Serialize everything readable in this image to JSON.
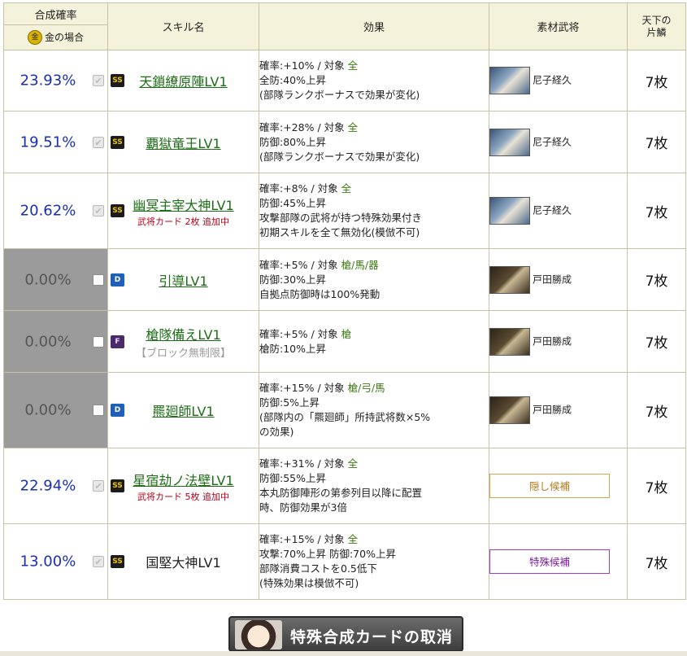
{
  "header": {
    "rate_title": "合成確率",
    "rate_gold_icon": "金",
    "rate_gold_label": "金の場合",
    "skill_name": "スキル名",
    "effect": "効果",
    "material": "素材武将",
    "count_line1": "天下の",
    "count_line2": "片鱗"
  },
  "rows": [
    {
      "rate": "23.93%",
      "checkbox": "checked-disabled",
      "rank": "SS",
      "name": "天鎖繚原陣LV1",
      "linked": true,
      "sub": "",
      "effects": [
        {
          "pre": "確率:+10%  /  対象  ",
          "tgt": "全"
        },
        {
          "pre": "全防:40%上昇"
        },
        {
          "pre": "(部隊ランクボーナスで効果が変化)"
        }
      ],
      "material": {
        "type": "general",
        "portrait": "blue",
        "name": "尼子経久"
      },
      "count": "7枚"
    },
    {
      "rate": "19.51%",
      "checkbox": "checked-disabled",
      "rank": "SS",
      "name": "覇獄竜王LV1",
      "linked": true,
      "sub": "",
      "effects": [
        {
          "pre": "確率:+28%  /  対象  ",
          "tgt": "全"
        },
        {
          "pre": "防御:80%上昇"
        },
        {
          "pre": "(部隊ランクボーナスで効果が変化)"
        }
      ],
      "material": {
        "type": "general",
        "portrait": "blue",
        "name": "尼子経久"
      },
      "count": "7枚"
    },
    {
      "rate": "20.62%",
      "checkbox": "checked-disabled",
      "rank": "SS",
      "name": "幽冥主宰大神LV1",
      "linked": true,
      "sub": "武将カード 2枚 追加中",
      "effects": [
        {
          "pre": "確率:+8%  /  対象  ",
          "tgt": "全"
        },
        {
          "pre": "防御:45%上昇"
        },
        {
          "pre": "攻撃部隊の武将が持つ特殊効果付き"
        },
        {
          "pre": "初期スキルを全て無効化(模倣不可)"
        }
      ],
      "material": {
        "type": "general",
        "portrait": "blue",
        "name": "尼子経久"
      },
      "count": "7枚"
    },
    {
      "rate": "0.00%",
      "grey": true,
      "checkbox": "empty",
      "rank": "D",
      "name": "引導LV1",
      "linked": true,
      "sub": "",
      "effects": [
        {
          "pre": "確率:+5%  /  対象  ",
          "tgt": "槍/馬/器"
        },
        {
          "pre": "防御:30%上昇"
        },
        {
          "pre": "自拠点防御時は100%発動"
        }
      ],
      "material": {
        "type": "general",
        "portrait": "dark",
        "name": "戸田勝成"
      },
      "count": "7枚"
    },
    {
      "rate": "0.00%",
      "grey": true,
      "checkbox": "empty",
      "rank": "F",
      "name": "槍隊備えLV1",
      "linked": true,
      "sub": "【ブロック無制限】",
      "subBlock": true,
      "effects": [
        {
          "pre": "確率:+5%  /  対象  ",
          "tgt": "槍"
        },
        {
          "pre": "槍防:10%上昇"
        }
      ],
      "material": {
        "type": "general",
        "portrait": "dark",
        "name": "戸田勝成"
      },
      "count": "7枚"
    },
    {
      "rate": "0.00%",
      "grey": true,
      "checkbox": "empty",
      "rank": "D",
      "name": "羆廻師LV1",
      "linked": true,
      "sub": "",
      "effects": [
        {
          "pre": "確率:+15%  /  対象  ",
          "tgt": "槍/弓/馬"
        },
        {
          "pre": "防御:5%上昇"
        },
        {
          "pre": "(部隊内の「羆廻師」所持武将数×5%"
        },
        {
          "pre": "の効果)"
        }
      ],
      "material": {
        "type": "general",
        "portrait": "dark",
        "name": "戸田勝成"
      },
      "count": "7枚"
    },
    {
      "rate": "22.94%",
      "checkbox": "checked-disabled",
      "rank": "SS",
      "name": "星宿劫ノ法壁LV1",
      "linked": true,
      "sub": "武将カード 5枚 追加中",
      "effects": [
        {
          "pre": "確率:+31%  /  対象  ",
          "tgt": "全"
        },
        {
          "pre": "防御:55%上昇"
        },
        {
          "pre": "本丸防御陣形の第参列目以降に配置"
        },
        {
          "pre": "時、防御効果が3倍"
        }
      ],
      "material": {
        "type": "candidate",
        "style": "hidden",
        "label": "隠し候補"
      },
      "count": "7枚"
    },
    {
      "rate": "13.00%",
      "checkbox": "checked-disabled",
      "rank": "SS",
      "name": "国堅大神LV1",
      "linked": false,
      "sub": "",
      "effects": [
        {
          "pre": "確率:+15%  /  対象  ",
          "tgt": "全"
        },
        {
          "pre": "攻撃:70%上昇  防御:70%上昇"
        },
        {
          "pre": "部隊消費コストを0.5低下"
        },
        {
          "pre": "(特殊効果は模倣不可)"
        }
      ],
      "material": {
        "type": "candidate",
        "style": "special",
        "label": "特殊候補"
      },
      "count": "7枚"
    }
  ],
  "cancel_button": {
    "label": "特殊合成カードの取消"
  },
  "colors": {
    "rate_blue": "#1a2fb0",
    "grey_cell": "#9b9b9b",
    "header_bg": "#f4f2db",
    "skill_link": "#1d6e17",
    "target_green": "#3d7a10"
  }
}
